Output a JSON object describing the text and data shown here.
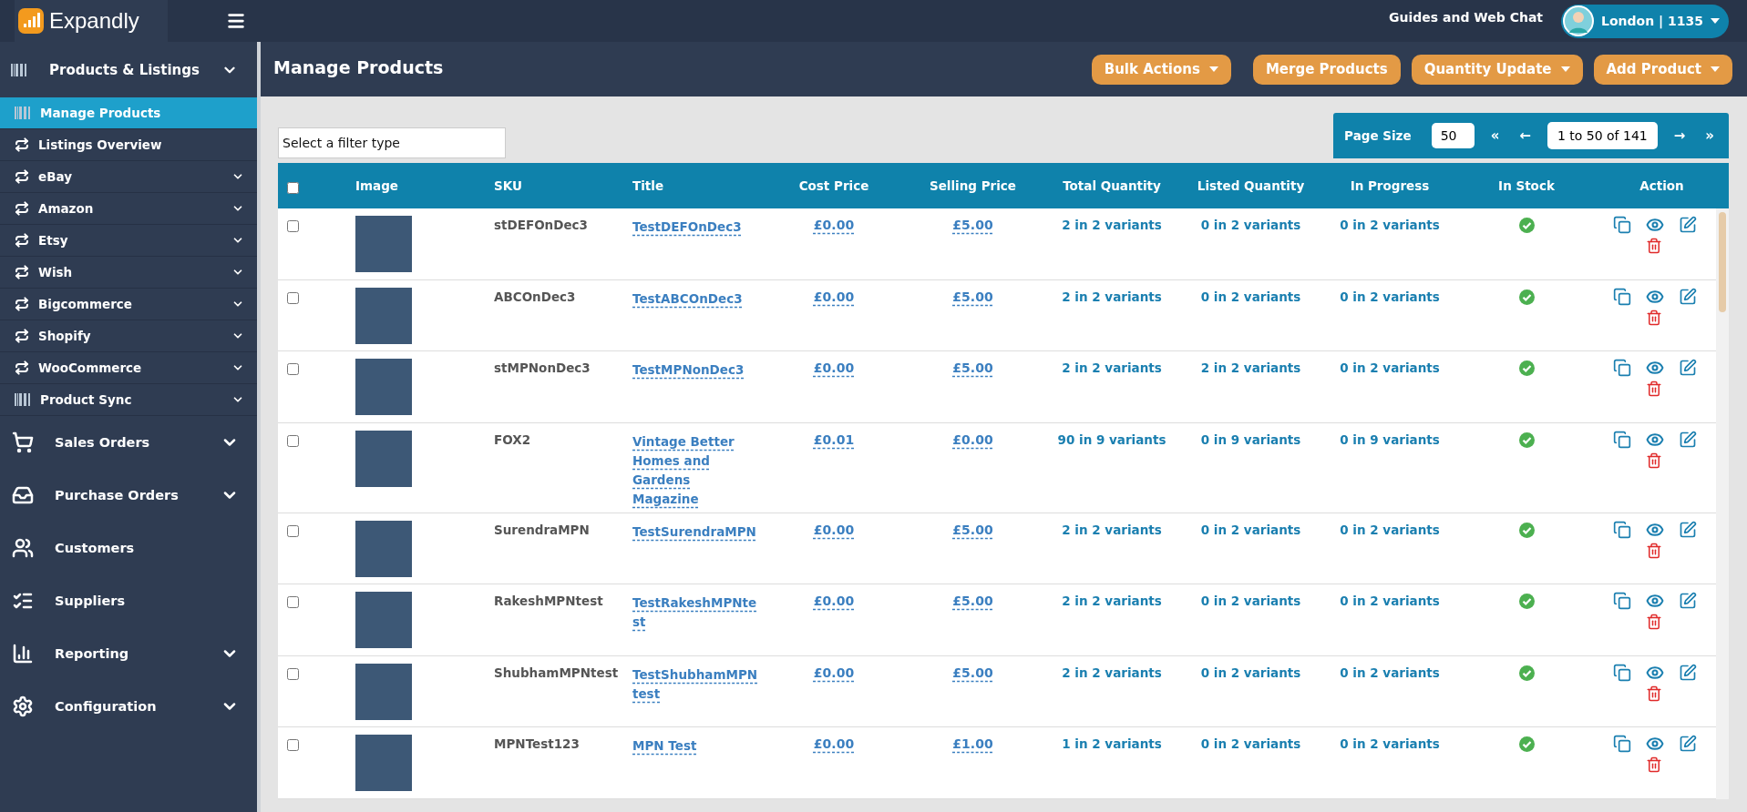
{
  "brand": {
    "name": "Expandly"
  },
  "top_bar": {
    "help_link": "Guides and Web Chat",
    "account": "London | 1135"
  },
  "sidebar": {
    "section": {
      "label": "Products & Listings",
      "expanded": true
    },
    "sub_items": [
      {
        "label": "Manage Products",
        "kind": "barcode",
        "selected": true,
        "has_submenu": false
      },
      {
        "label": "Listings Overview",
        "kind": "sync",
        "selected": false,
        "has_submenu": false
      },
      {
        "label": "eBay",
        "kind": "sync",
        "selected": false,
        "has_submenu": true
      },
      {
        "label": "Amazon",
        "kind": "sync",
        "selected": false,
        "has_submenu": true
      },
      {
        "label": "Etsy",
        "kind": "sync",
        "selected": false,
        "has_submenu": true
      },
      {
        "label": "Wish",
        "kind": "sync",
        "selected": false,
        "has_submenu": true
      },
      {
        "label": "Bigcommerce",
        "kind": "sync",
        "selected": false,
        "has_submenu": true
      },
      {
        "label": "Shopify",
        "kind": "sync",
        "selected": false,
        "has_submenu": true
      },
      {
        "label": "WooCommerce",
        "kind": "sync",
        "selected": false,
        "has_submenu": true
      },
      {
        "label": "Product Sync",
        "kind": "barcode",
        "selected": false,
        "has_submenu": true
      }
    ],
    "items": [
      {
        "label": "Sales Orders",
        "kind": "cart",
        "has_submenu": true
      },
      {
        "label": "Purchase Orders",
        "kind": "inbox",
        "has_submenu": true
      },
      {
        "label": "Customers",
        "kind": "users",
        "has_submenu": false
      },
      {
        "label": "Suppliers",
        "kind": "list",
        "has_submenu": false
      },
      {
        "label": "Reporting",
        "kind": "chart",
        "has_submenu": true
      },
      {
        "label": "Configuration",
        "kind": "gears",
        "has_submenu": true
      }
    ]
  },
  "page": {
    "title": "Manage Products",
    "actions": [
      {
        "label": "Bulk Actions",
        "dropdown": true
      },
      {
        "label": "Merge Products",
        "dropdown": false
      },
      {
        "label": "Quantity Update",
        "dropdown": true
      },
      {
        "label": "Add Product",
        "dropdown": true
      }
    ],
    "filter": {
      "placeholder": "Select a filter type"
    },
    "pagination": {
      "label": "Page Size",
      "page_size": "50",
      "first": "«",
      "prev": "←",
      "range": "1 to 50 of 141",
      "next": "→",
      "last": "»"
    }
  },
  "table": {
    "select_all": {
      "checked": false
    },
    "columns": [
      "Image",
      "SKU",
      "Title",
      "Cost Price",
      "Selling Price",
      "Total Quantity",
      "Listed Quantity",
      "In Progress",
      "In Stock",
      "Action"
    ],
    "rows": [
      {
        "checked": false,
        "sku": "stDEFOnDec3",
        "title": "TestDEFOnDec3",
        "cost": "£0.00",
        "price": "£5.00",
        "total": "2 in 2 variants",
        "listed": "0 in 2 variants",
        "in_progress": "0 in 2 variants",
        "in_stock": true
      },
      {
        "checked": false,
        "sku": "ABCOnDec3",
        "title": "TestABCOnDec3",
        "cost": "£0.00",
        "price": "£5.00",
        "total": "2 in 2 variants",
        "listed": "0 in 2 variants",
        "in_progress": "0 in 2 variants",
        "in_stock": true
      },
      {
        "checked": false,
        "sku": "stMPNonDec3",
        "title": "TestMPNonDec3",
        "cost": "£0.00",
        "price": "£5.00",
        "total": "2 in 2 variants",
        "listed": "2 in 2 variants",
        "in_progress": "0 in 2 variants",
        "in_stock": true
      },
      {
        "checked": false,
        "sku": "FOX2",
        "title": "Vintage Better Homes and Gardens Magazine",
        "cost": "£0.01",
        "price": "£0.00",
        "total": "90 in 9 variants",
        "listed": "0 in 9 variants",
        "in_progress": "0 in 9 variants",
        "in_stock": true
      },
      {
        "checked": false,
        "sku": "SurendraMPN",
        "title": "TestSurendraMPN",
        "cost": "£0.00",
        "price": "£5.00",
        "total": "2 in 2 variants",
        "listed": "0 in 2 variants",
        "in_progress": "0 in 2 variants",
        "in_stock": true
      },
      {
        "checked": false,
        "sku": "RakeshMPNtest",
        "title": "TestRakeshMPNtest",
        "cost": "£0.00",
        "price": "£5.00",
        "total": "2 in 2 variants",
        "listed": "0 in 2 variants",
        "in_progress": "0 in 2 variants",
        "in_stock": true
      },
      {
        "checked": false,
        "sku": "ShubhamMPNtest",
        "title": "TestShubhamMPN test",
        "cost": "£0.00",
        "price": "£5.00",
        "total": "2 in 2 variants",
        "listed": "0 in 2 variants",
        "in_progress": "0 in 2 variants",
        "in_stock": true
      },
      {
        "checked": false,
        "sku": "MPNTest123",
        "title": "MPN Test",
        "cost": "£0.00",
        "price": "£1.00",
        "total": "1 in 2 variants",
        "listed": "0 in 2 variants",
        "in_progress": "0 in 2 variants",
        "in_stock": true
      }
    ]
  }
}
